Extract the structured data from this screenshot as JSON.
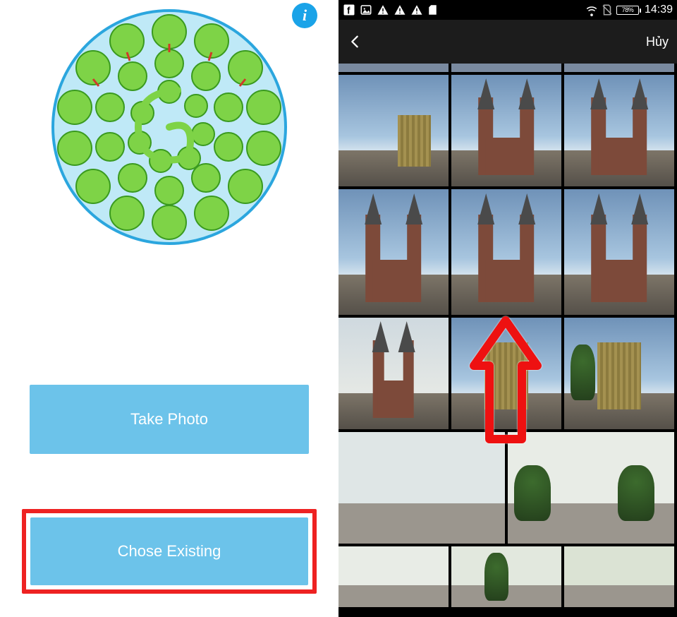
{
  "left": {
    "info_label": "i",
    "take_photo_label": "Take Photo",
    "chose_existing_label": "Chose Existing"
  },
  "right": {
    "status": {
      "battery_text": "78%",
      "time": "14:39"
    },
    "nav": {
      "cancel_label": "Hủy"
    }
  }
}
